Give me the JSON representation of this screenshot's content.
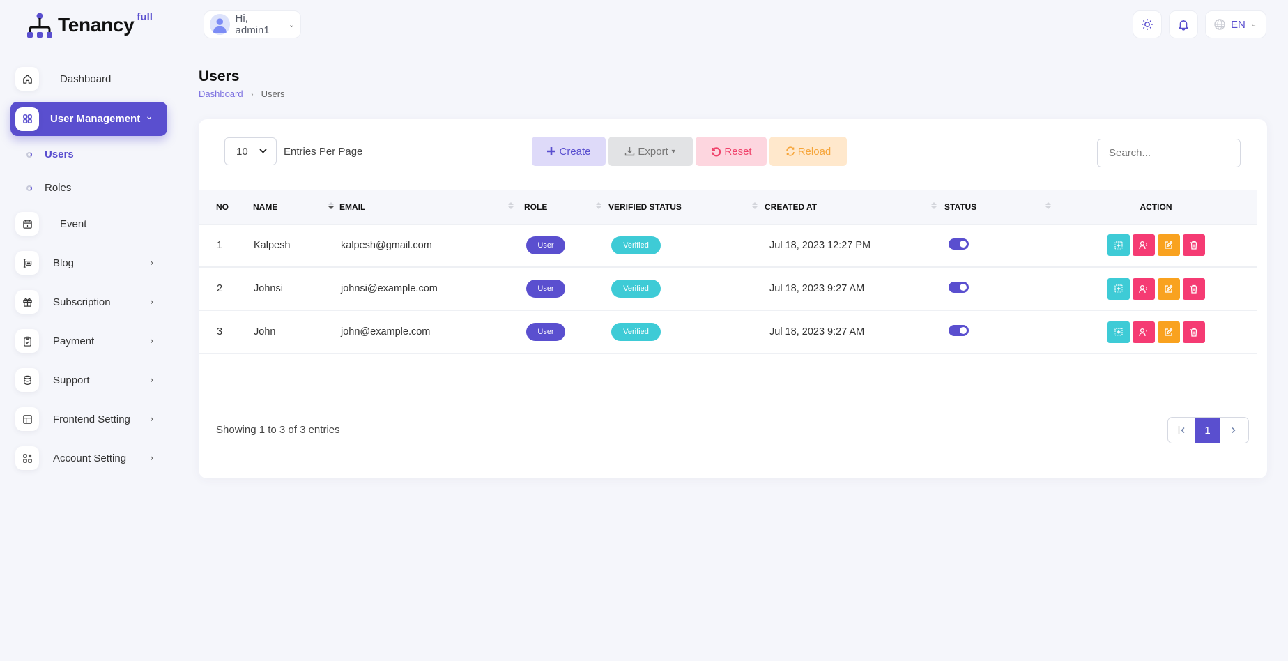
{
  "brand": {
    "name": "Tenancy",
    "superscript": "full"
  },
  "header": {
    "user_greeting": "Hi, admin1",
    "language": "EN",
    "icons": {
      "theme": "sun-icon",
      "notifications": "bell-icon",
      "language": "globe-icon"
    }
  },
  "sidebar": {
    "items": [
      {
        "label": "Dashboard",
        "icon": "home-icon",
        "has_arrow": false
      },
      {
        "label": "User Management",
        "icon": "grid-icon",
        "active": true,
        "expanded": true,
        "children": [
          {
            "label": "Users",
            "active": true
          },
          {
            "label": "Roles",
            "active": false
          }
        ]
      },
      {
        "label": "Event",
        "icon": "calendar-icon",
        "has_arrow": false
      },
      {
        "label": "Blog",
        "icon": "blog-icon",
        "has_arrow": true
      },
      {
        "label": "Subscription",
        "icon": "gift-icon",
        "has_arrow": true
      },
      {
        "label": "Payment",
        "icon": "clipboard-check-icon",
        "has_arrow": true
      },
      {
        "label": "Support",
        "icon": "database-icon",
        "has_arrow": true
      },
      {
        "label": "Frontend Setting",
        "icon": "layout-icon",
        "has_arrow": true
      },
      {
        "label": "Account Setting",
        "icon": "apps-add-icon",
        "has_arrow": true
      }
    ]
  },
  "page": {
    "title": "Users",
    "breadcrumb": [
      {
        "label": "Dashboard",
        "link": true
      },
      {
        "label": "Users",
        "link": false
      }
    ]
  },
  "table_controls": {
    "entries_value": "10",
    "entries_label": "Entries Per Page",
    "buttons": {
      "create": "Create",
      "export": "Export",
      "reset": "Reset",
      "reload": "Reload"
    },
    "search_placeholder": "Search..."
  },
  "table": {
    "columns": [
      "NO",
      "NAME",
      "EMAIL",
      "ROLE",
      "VERIFIED STATUS",
      "CREATED AT",
      "STATUS",
      "ACTION"
    ],
    "rows": [
      {
        "no": "1",
        "name": "Kalpesh",
        "email": "kalpesh@gmail.com",
        "role": "User",
        "verified": "Verified",
        "created_at": "Jul 18, 2023 12:27 PM",
        "status_on": true
      },
      {
        "no": "2",
        "name": "Johnsi",
        "email": "johnsi@example.com",
        "role": "User",
        "verified": "Verified",
        "created_at": "Jul 18, 2023 9:27 AM",
        "status_on": true
      },
      {
        "no": "3",
        "name": "John",
        "email": "john@example.com",
        "role": "User",
        "verified": "Verified",
        "created_at": "Jul 18, 2023 9:27 AM",
        "status_on": true
      }
    ],
    "row_actions": [
      "view-icon",
      "user-permission-icon",
      "edit-icon",
      "delete-icon"
    ]
  },
  "footer": {
    "showing": "Showing 1 to 3 of 3 entries",
    "pagination": {
      "current": "1"
    }
  },
  "colors": {
    "primary": "#5a4fcf",
    "teal": "#3ecbd6",
    "pink": "#f53b73",
    "orange": "#f9a21f"
  }
}
